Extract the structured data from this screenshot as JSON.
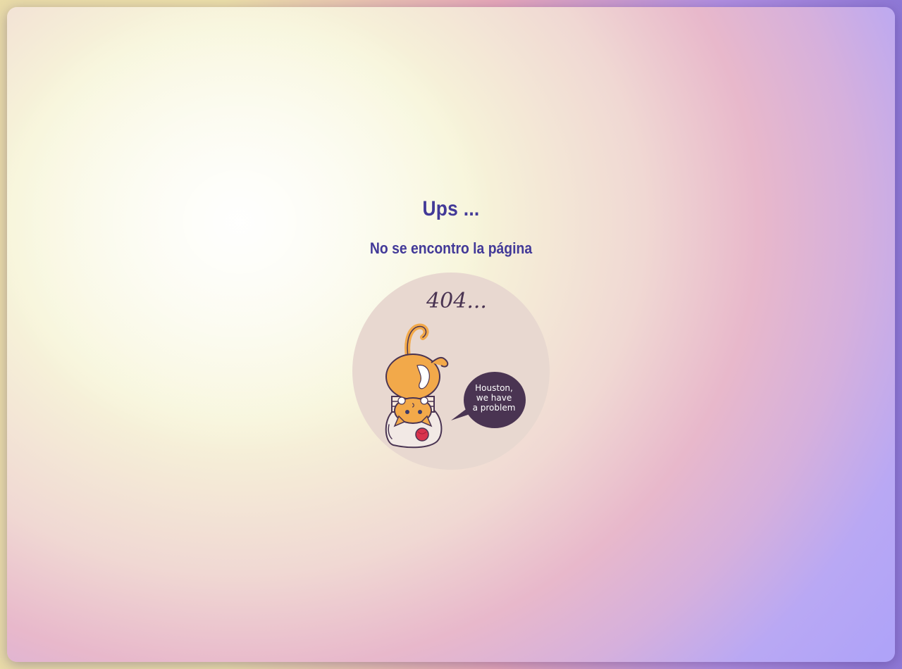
{
  "page": {
    "title": "Ups ...",
    "subtitle": "No se encontro la página"
  },
  "illustration": {
    "code_text": "404...",
    "bubble_lines": [
      "Houston,",
      "we have",
      "a problem"
    ]
  },
  "colors": {
    "heading": "#423998",
    "circle_bg": "#e8d8d0",
    "cat_orange": "#f2a94a",
    "bubble": "#4a3452",
    "ball": "#d8334d"
  },
  "icons": {
    "illustration": "cat-in-jar-icon",
    "bubble": "speech-bubble-icon"
  }
}
